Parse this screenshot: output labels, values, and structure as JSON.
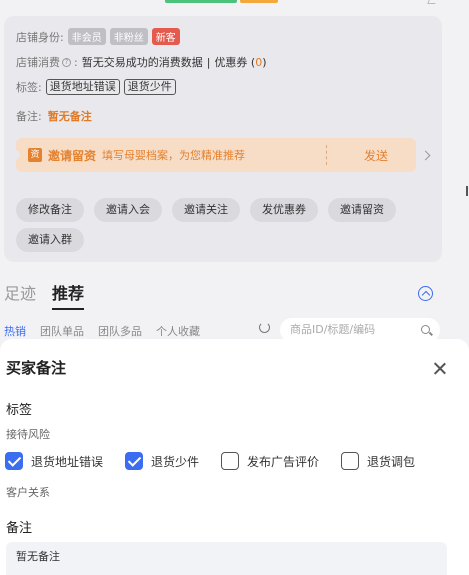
{
  "shop": {
    "identity_label": "店铺身份:",
    "identity_tags": [
      "非会员",
      "非粉丝"
    ],
    "new_tag": "新客",
    "consume_label": "店铺消费",
    "consume_value": "暂无交易成功的消费数据",
    "coupon_text": "优惠券 (",
    "coupon_count": "0",
    "coupon_close": ")",
    "tags_label": "标签:",
    "tags": [
      "退货地址错误",
      "退货少件"
    ],
    "note_label": "备注:",
    "note_value": "暂无备注"
  },
  "invite": {
    "title": "邀请留资",
    "desc": "填写母婴档案，为您精准推荐",
    "send": "发送",
    "icon": "资"
  },
  "actions": [
    "修改备注",
    "邀请入会",
    "邀请关注",
    "发优惠券",
    "邀请留资",
    "邀请入群"
  ],
  "tabs": {
    "footprint": "足迹",
    "recommend": "推荐"
  },
  "subtabs": [
    "热销",
    "团队单品",
    "团队多品",
    "个人收藏"
  ],
  "search": {
    "placeholder": "商品ID/标题/编码"
  },
  "modal": {
    "title": "买家备注",
    "tags_section": "标签",
    "risk_label": "接待风险",
    "options": [
      {
        "label": "退货地址错误",
        "checked": true
      },
      {
        "label": "退货少件",
        "checked": true
      },
      {
        "label": "发布广告评价",
        "checked": false
      },
      {
        "label": "退货调包",
        "checked": false
      }
    ],
    "customer_label": "客户关系",
    "note_section": "备注",
    "note_value": "暂无备注"
  },
  "colors": {
    "accent": "#3b6df1",
    "orange": "#e4822f",
    "red_tag": "#e55a4e"
  }
}
